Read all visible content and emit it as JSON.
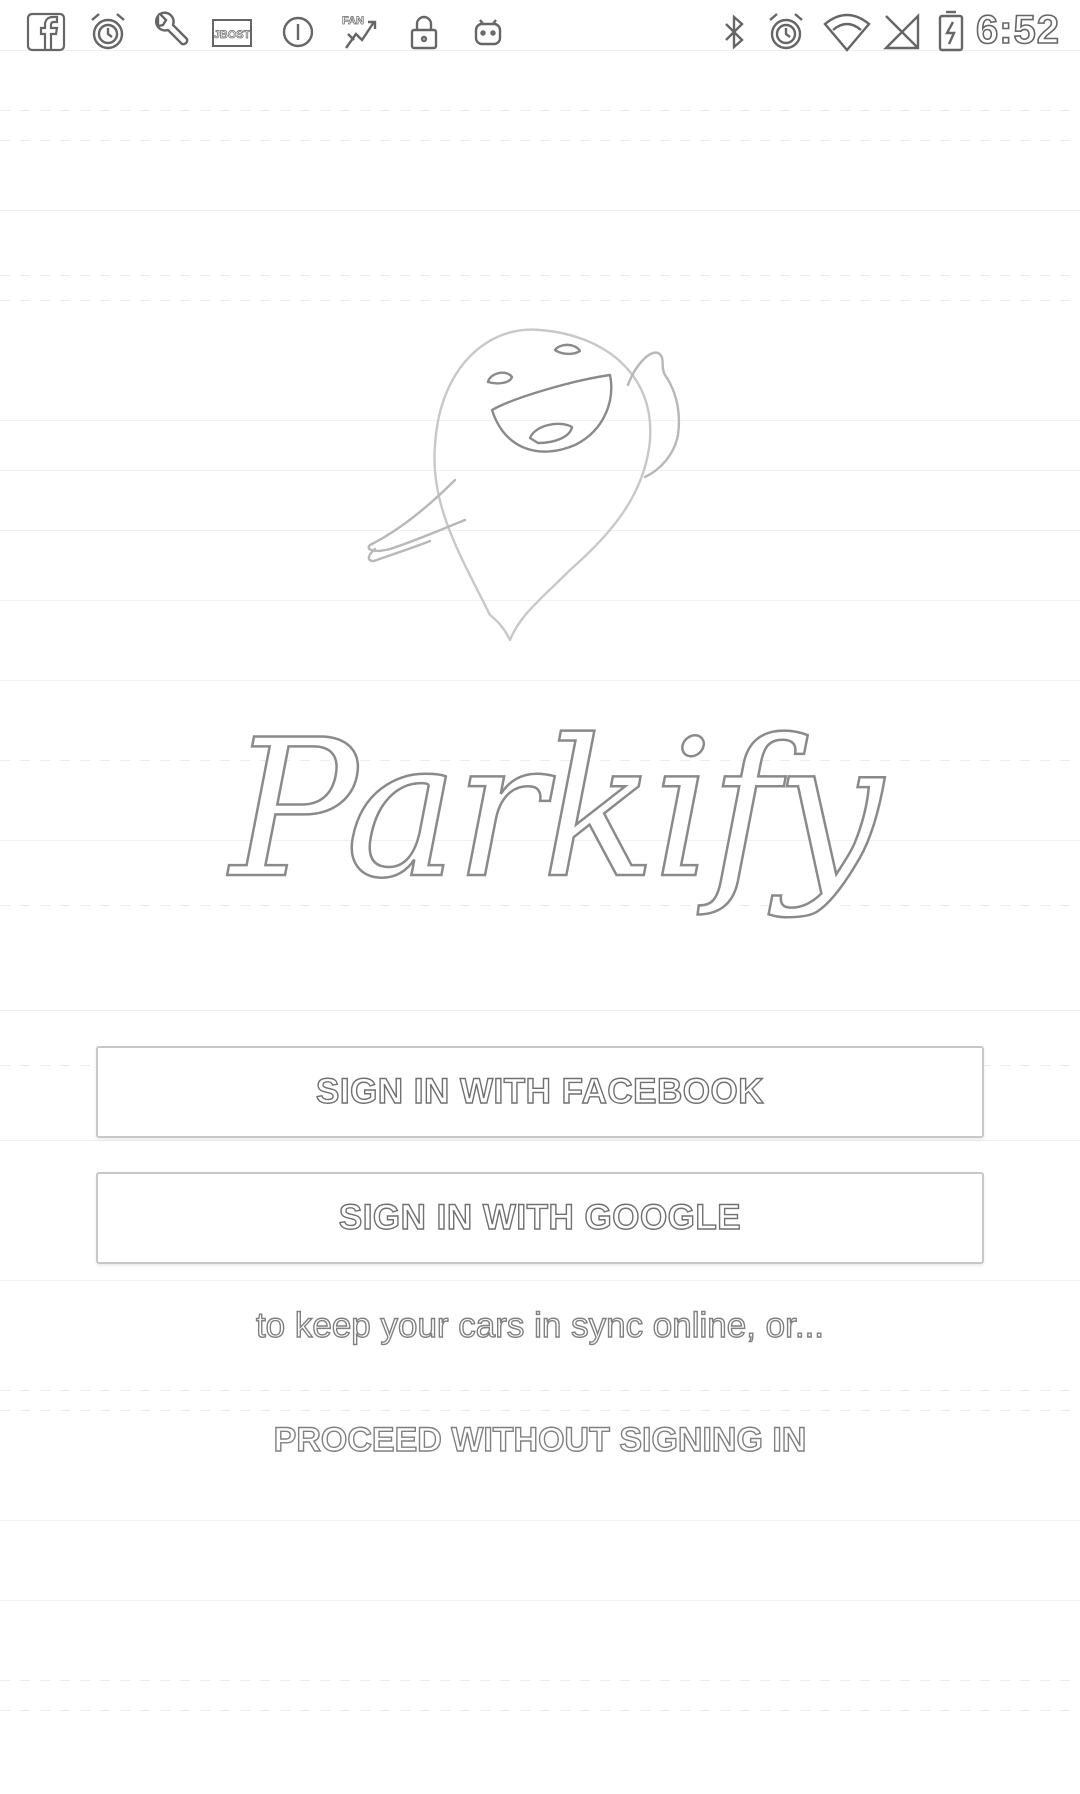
{
  "status_bar": {
    "left_icons": [
      "facebook-icon",
      "alarm-icon",
      "wrench-icon",
      "jbost-icon",
      "circle-icon",
      "fan-icon",
      "lock-icon",
      "android-icon"
    ],
    "jbost_label": "JBOST",
    "fan_label": "FAN",
    "right_icons": [
      "bluetooth-icon",
      "alarm-icon",
      "wifi-icon",
      "no-sim-icon",
      "battery-charging-icon"
    ],
    "time": "6:52"
  },
  "app": {
    "name": "Parkify",
    "mascot": "ghost-pin-mascot"
  },
  "buttons": {
    "facebook_label": "SIGN IN WITH FACEBOOK",
    "google_label": "SIGN IN WITH GOOGLE"
  },
  "sync_text": "to keep your cars in sync online, or...",
  "proceed_label": "PROCEED WITHOUT SIGNING IN",
  "colors": {
    "background": "#ffffff",
    "outline": "#707070",
    "button_border": "#c8c8c8"
  }
}
